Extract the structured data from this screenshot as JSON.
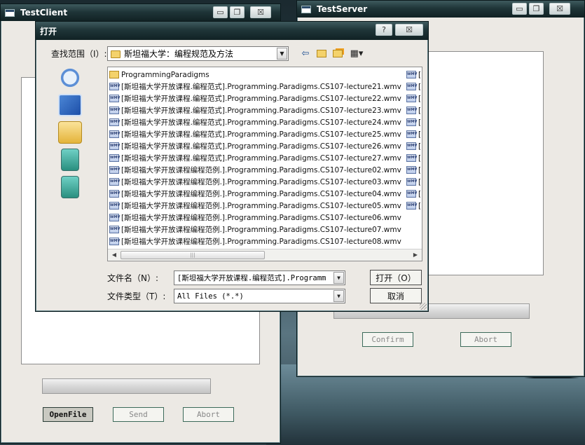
{
  "client": {
    "title": "TestClient",
    "buttons": {
      "open_file": "OpenFile",
      "send": "Send",
      "abort": "Abort"
    },
    "progress": 0
  },
  "server": {
    "title": "TestServer",
    "buttons": {
      "confirm": "Confirm",
      "abort": "Abort"
    },
    "progress": 0
  },
  "dialog": {
    "title": "打开",
    "look_in_label": "查找范围（I）:",
    "look_in_value": "斯坦福大学：编程规范及方法",
    "file_name_label": "文件名（N）:",
    "file_name_value": "[斯坦福大学开放课程.编程范式].Programm",
    "file_type_label": "文件类型（T）:",
    "file_type_value": "All Files (*.*)",
    "open_button": "打开（O）",
    "cancel_button": "取消",
    "help_glyph": "?",
    "close_glyph": "☒",
    "folder": "ProgrammingParadigms",
    "files": [
      "[斯坦福大学开放课程.编程范式].Programming.Paradigms.CS107-lecture21.wmv",
      "[斯坦福大学开放课程.编程范式].Programming.Paradigms.CS107-lecture22.wmv",
      "[斯坦福大学开放课程.编程范式].Programming.Paradigms.CS107-lecture23.wmv",
      "[斯坦福大学开放课程.编程范式].Programming.Paradigms.CS107-lecture24.wmv",
      "[斯坦福大学开放课程.编程范式].Programming.Paradigms.CS107-lecture25.wmv",
      "[斯坦福大学开放课程.编程范式].Programming.Paradigms.CS107-lecture26.wmv",
      "[斯坦福大学开放课程.编程范式].Programming.Paradigms.CS107-lecture27.wmv",
      "[斯坦福大学开放课程编程范例.].Programming.Paradigms.CS107-lecture02.wmv",
      "[斯坦福大学开放课程编程范例.].Programming.Paradigms.CS107-lecture03.wmv",
      "[斯坦福大学开放课程编程范例.].Programming.Paradigms.CS107-lecture04.wmv",
      "[斯坦福大学开放课程编程范例.].Programming.Paradigms.CS107-lecture05.wmv",
      "[斯坦福大学开放课程编程范例.].Programming.Paradigms.CS107-lecture06.wmv",
      "[斯坦福大学开放课程编程范例.].Programming.Paradigms.CS107-lecture07.wmv",
      "[斯坦福大学开放课程编程范例.].Programming.Paradigms.CS107-lecture08.wmv"
    ],
    "second_column_rows": 12,
    "second_column_glyph": "[",
    "scroll_grip": "|||",
    "icons": [
      "back-arrow-icon",
      "up-folder-icon",
      "new-folder-icon",
      "view-menu-icon"
    ],
    "places": [
      "recent-documents-icon",
      "desktop-icon",
      "my-documents-icon",
      "my-computer-icon",
      "network-places-icon"
    ]
  },
  "window_controls": {
    "minimize": "▭",
    "restore": "❐",
    "close": "☒"
  },
  "colors": {
    "titlebar": "#1f3538",
    "window_bg": "#ece9e4",
    "button_border": "#3c6a5a"
  }
}
